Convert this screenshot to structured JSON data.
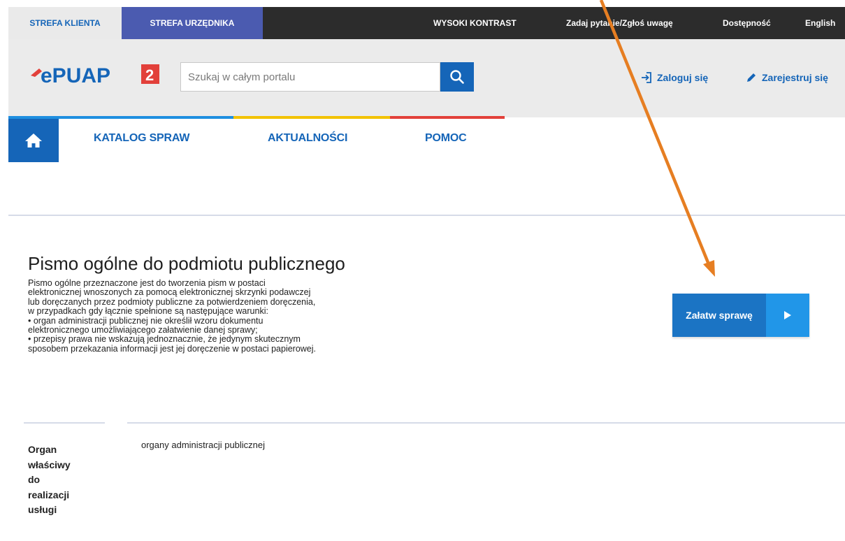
{
  "topbar": {
    "zone_client": "STREFA KLIENTA",
    "zone_official": "STREFA URZĘDNIKA",
    "high_contrast": "WYSOKI KONTRAST",
    "ask_question": "Zadaj pytanie/Zgłoś uwagę",
    "accessibility": "Dostępność",
    "english": "English"
  },
  "header": {
    "logo_text": "ePUAP",
    "logo_number": "2",
    "search_placeholder": "Szukaj w całym portalu",
    "login": "Zaloguj się",
    "register": "Zarejestruj się"
  },
  "nav": {
    "home_icon": "home-icon",
    "items": [
      "KATALOG SPRAW",
      "AKTUALNOŚCI",
      "POMOC"
    ]
  },
  "main": {
    "title": "Pismo ogólne do podmiotu publicznego",
    "description_lines": [
      "Pismo ogólne przeznaczone jest do tworzenia pism w postaci",
      "elektronicznej wnoszonych za pomocą elektronicznej skrzynki podawczej",
      "lub doręczanych przez podmioty publiczne za potwierdzeniem doręczenia,",
      "w przypadkach gdy łącznie spełnione są następujące warunki:",
      "• organ administracji publicznej nie określił wzoru dokumentu",
      "elektronicznego umożliwiającego załatwienie danej sprawy;",
      "• przepisy prawa nie wskazują jednoznacznie, że jedynym skutecznym",
      "sposobem przekazania informacji jest jej doręczenie w postaci papierowej."
    ],
    "action_button": "Załatw sprawę",
    "organ_label_lines": [
      "Organ",
      "właściwy",
      "do",
      "realizacji",
      "usługi"
    ],
    "organ_value": "organy administracji publicznej"
  },
  "colors": {
    "brand_blue": "#1565b8",
    "stripe_blue": "#1f8fe0",
    "stripe_yellow": "#f2c200",
    "stripe_red": "#e2403a",
    "annotation_arrow": "#e67e22"
  }
}
